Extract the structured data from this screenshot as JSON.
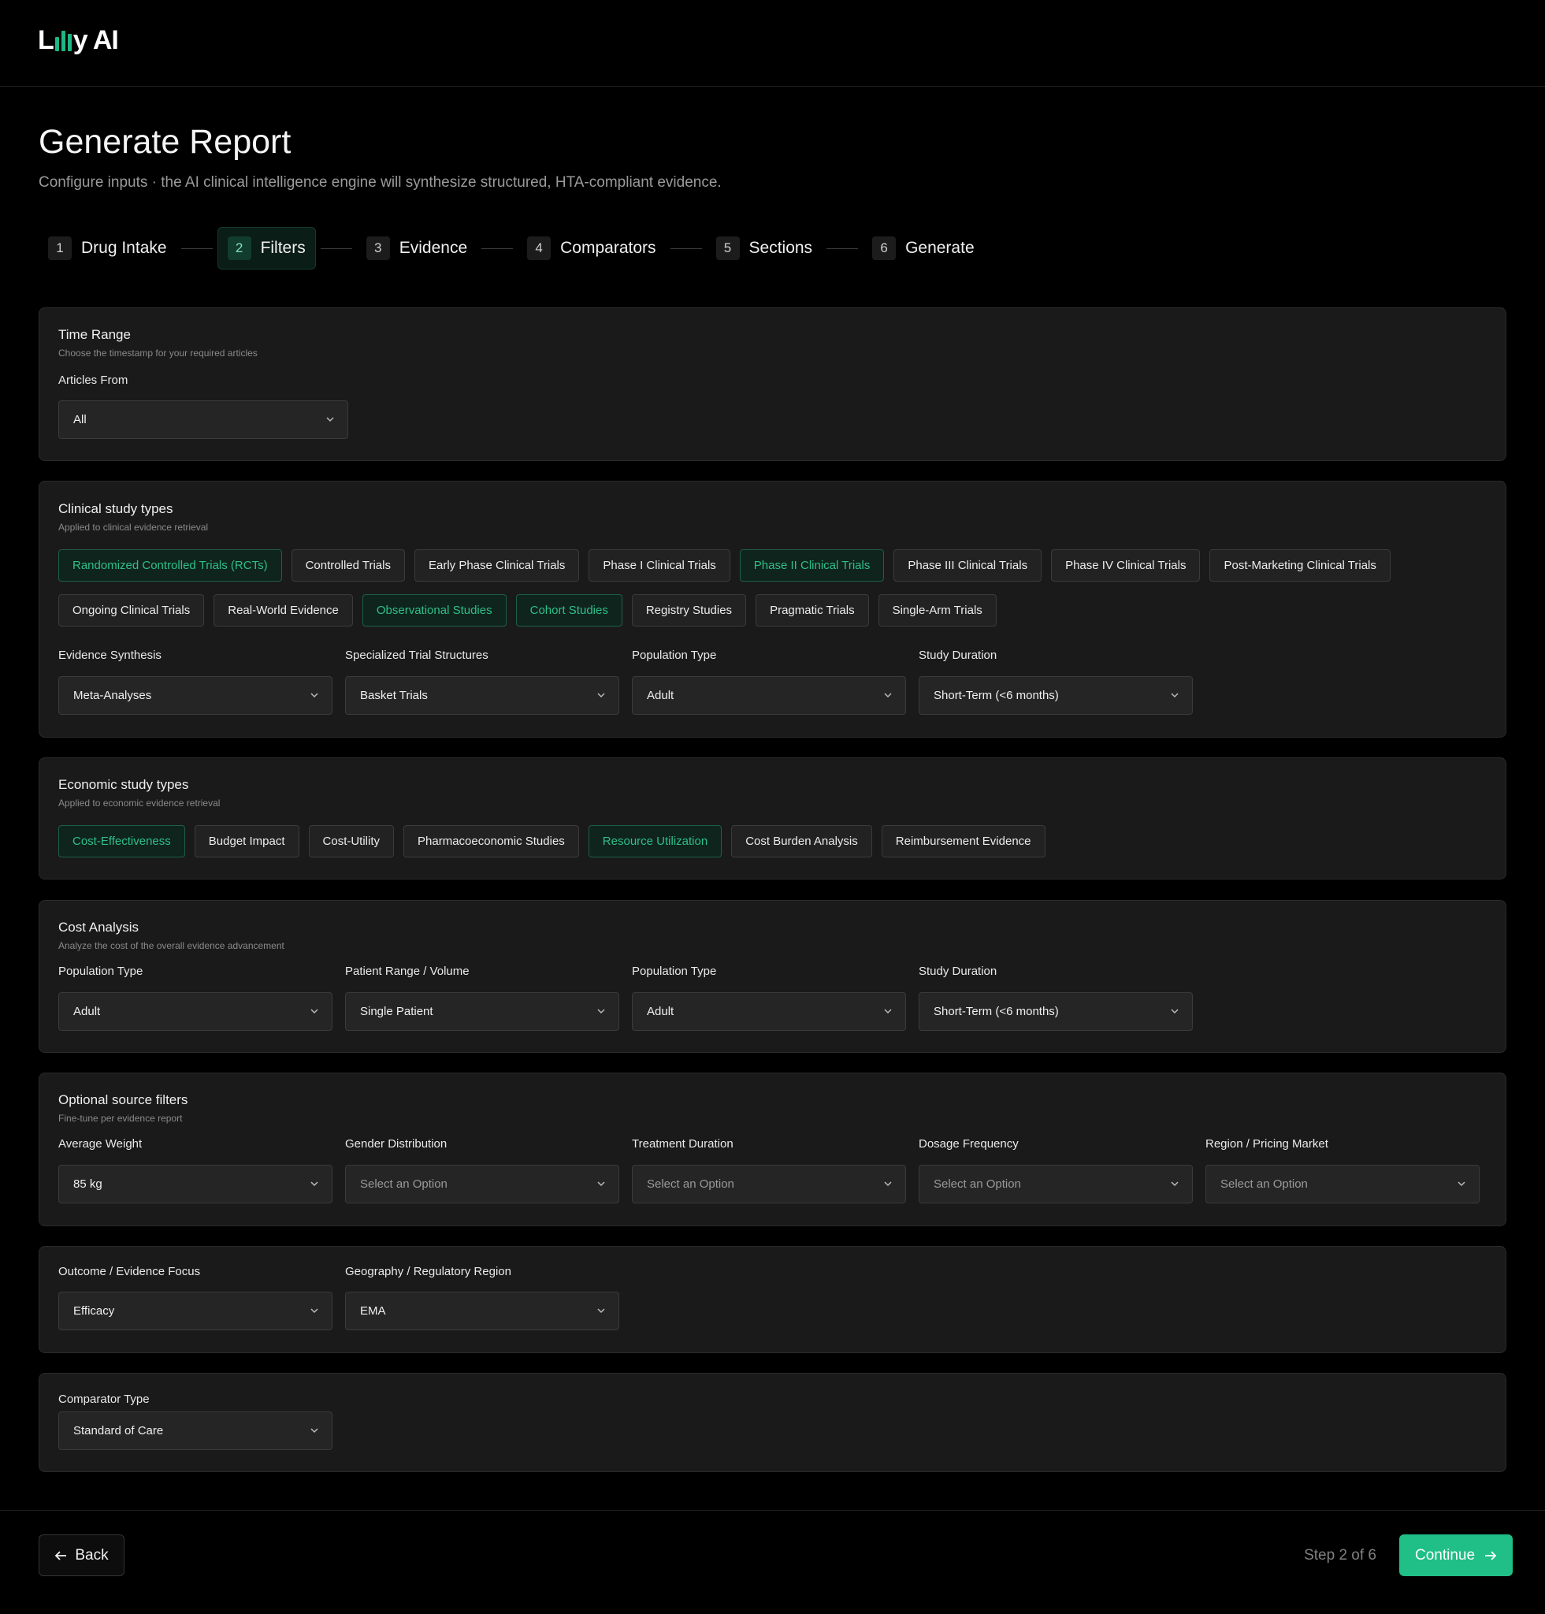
{
  "brand": {
    "name_left": "L",
    "name_right": "y AI",
    "accent": "#1fb585"
  },
  "header": {
    "title": "Generate Report",
    "subtitle": "Configure inputs · the AI clinical intelligence engine will synthesize structured, HTA-compliant evidence."
  },
  "steps": [
    {
      "num": "1",
      "label": "Drug Intake"
    },
    {
      "num": "2",
      "label": "Filters",
      "active": true
    },
    {
      "num": "3",
      "label": "Evidence"
    },
    {
      "num": "4",
      "label": "Comparators"
    },
    {
      "num": "5",
      "label": "Sections"
    },
    {
      "num": "6",
      "label": "Generate"
    }
  ],
  "time_range": {
    "title": "Time Range",
    "subtitle": "Choose the timestamp for your required articles",
    "articles_from_label": "Articles From",
    "articles_from_value": "All"
  },
  "clinical": {
    "title": "Clinical study types",
    "subtitle": "Applied to clinical evidence retrieval",
    "chips": [
      {
        "label": "Randomized Controlled Trials (RCTs)",
        "selected": true
      },
      {
        "label": "Controlled Trials",
        "selected": false
      },
      {
        "label": "Early Phase Clinical Trials",
        "selected": false
      },
      {
        "label": "Phase I Clinical Trials",
        "selected": false
      },
      {
        "label": "Phase II Clinical Trials",
        "selected": true
      },
      {
        "label": "Phase III Clinical Trials",
        "selected": false
      },
      {
        "label": "Phase IV Clinical Trials",
        "selected": false
      },
      {
        "label": "Post-Marketing Clinical Trials",
        "selected": false
      },
      {
        "label": "Ongoing Clinical Trials",
        "selected": false
      },
      {
        "label": "Real-World Evidence",
        "selected": false
      },
      {
        "label": "Observational Studies",
        "selected": true
      },
      {
        "label": "Cohort Studies",
        "selected": true
      },
      {
        "label": "Registry Studies",
        "selected": false
      },
      {
        "label": "Pragmatic Trials",
        "selected": false
      },
      {
        "label": "Single-Arm Trials",
        "selected": false
      }
    ],
    "fields": {
      "evidence_synthesis_label": "Evidence Synthesis",
      "evidence_synthesis_value": "Meta-Analyses",
      "trial_structures_label": "Specialized Trial Structures",
      "trial_structures_value": "Basket Trials",
      "population_label": "Population Type",
      "population_value": "Adult",
      "duration_label": "Study Duration",
      "duration_value": "Short-Term (<6 months)"
    }
  },
  "economic": {
    "title": "Economic study types",
    "subtitle": "Applied to economic evidence retrieval",
    "chips": [
      {
        "label": "Cost-Effectiveness",
        "selected": true
      },
      {
        "label": "Budget Impact",
        "selected": false
      },
      {
        "label": "Cost-Utility",
        "selected": false
      },
      {
        "label": "Pharmacoeconomic Studies",
        "selected": false
      },
      {
        "label": "Resource Utilization",
        "selected": true
      },
      {
        "label": "Cost Burden Analysis",
        "selected": false
      },
      {
        "label": "Reimbursement Evidence",
        "selected": false
      }
    ]
  },
  "cost": {
    "title": "Cost Analysis",
    "subtitle": "Analyze the cost of the overall evidence advancement",
    "population_label": "Population Type",
    "population_value": "Adult",
    "patient_range_label": "Patient Range / Volume",
    "patient_range_value": "Single Patient",
    "population2_label": "Population Type",
    "population2_value": "Adult",
    "duration_label": "Study Duration",
    "duration_value": "Short-Term (<6 months)"
  },
  "optional": {
    "title": "Optional source filters",
    "subtitle": "Fine-tune per evidence report",
    "weight_label": "Average Weight",
    "weight_value": "85 kg",
    "gender_label": "Gender Distribution",
    "treatment_label": "Treatment Duration",
    "dosage_label": "Dosage Frequency",
    "region_label": "Region / Pricing Market",
    "placeholder": "Select an Option"
  },
  "outcome": {
    "focus_label": "Outcome / Evidence Focus",
    "focus_value": "Efficacy",
    "geo_label": "Geography / Regulatory Region",
    "geo_value": "EMA"
  },
  "comparator": {
    "type_label": "Comparator Type",
    "type_value": "Standard of Care"
  },
  "footer": {
    "back_label": "Back",
    "step_text": "Step 2 of 6",
    "continue_label": "Continue",
    "continue_color": "#1fbf87"
  }
}
